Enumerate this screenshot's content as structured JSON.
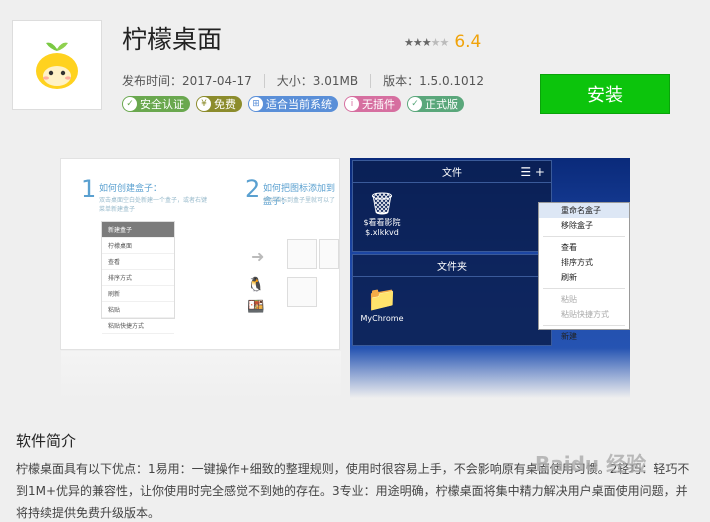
{
  "app": {
    "title": "柠檬桌面",
    "score": "6.4",
    "stars_filled": 3,
    "stars_total": 5,
    "install_label": "安装",
    "meta": {
      "publish": "发布时间：2017-04-17",
      "size": "大小：3.01MB",
      "version": "版本：1.5.0.1012"
    },
    "badges": [
      "安全认证",
      "免费",
      "适合当前系统",
      "无插件",
      "正式版"
    ]
  },
  "screenshot1": {
    "step1_num": "1",
    "step1_title": "如何创建盒子：",
    "step1_sub": "双击桌面空白处新建一个盒子，或者右键菜单新建盒子",
    "step2_num": "2",
    "step2_title": "如何把图标添加到盒子：",
    "step2_sub": "拖动图标到盒子里就可以了",
    "menu": [
      "新建盒子",
      "柠檬桌面",
      "查看",
      "排序方式",
      "刷新",
      "粘贴",
      "粘贴快捷方式"
    ]
  },
  "screenshot2": {
    "panel1_title": "文件",
    "panel2_title": "文件夹",
    "item1": "$看看影院\n$.xlkkvd",
    "item2": "MyChrome",
    "context_menu": [
      "重命名盒子",
      "移除盒子",
      "查看",
      "排序方式",
      "刷新",
      "粘贴",
      "粘贴快捷方式",
      "新建"
    ]
  },
  "intro": {
    "title": "软件简介",
    "text": "柠檬桌面具有以下优点：1易用：一键操作+细致的整理规则，使用时很容易上手，不会影响原有桌面使用习惯。2轻巧：轻巧不到1M+优异的兼容性，让你使用时完全感觉不到她的存在。3专业：用途明确，柠檬桌面将集中精力解决用户桌面使用问题，并将持续提供免费升级版本。"
  },
  "watermark": "Baidu 经验"
}
